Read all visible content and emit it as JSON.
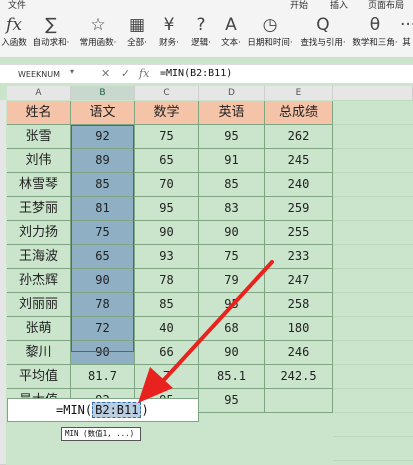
{
  "menu": {
    "start": "开始",
    "insert": "插入",
    "layout": "页面布局",
    "file": "文件"
  },
  "ribbon": [
    {
      "icon": "fx",
      "label": "入函数"
    },
    {
      "icon": "∑",
      "label": "自动求和·"
    },
    {
      "icon": "☆",
      "label": "常用函数·"
    },
    {
      "icon": "▦",
      "label": "全部·"
    },
    {
      "icon": "¥",
      "label": "财务·"
    },
    {
      "icon": "?",
      "label": "逻辑·"
    },
    {
      "icon": "A",
      "label": "文本·"
    },
    {
      "icon": "◷",
      "label": "日期和时间·"
    },
    {
      "icon": "Q",
      "label": "查找与引用·"
    },
    {
      "icon": "θ",
      "label": "数学和三角·"
    },
    {
      "icon": "···",
      "label": "其"
    }
  ],
  "formula_bar": {
    "name_box": "WEEKNUM",
    "formula": "=MIN(B2:B11)"
  },
  "columns": [
    "A",
    "B",
    "C",
    "D",
    "E"
  ],
  "table": {
    "headers": [
      "姓名",
      "语文",
      "数学",
      "英语",
      "总成绩"
    ],
    "rows": [
      [
        "张雪",
        "92",
        "75",
        "95",
        "262"
      ],
      [
        "刘伟",
        "89",
        "65",
        "91",
        "245"
      ],
      [
        "林雪琴",
        "85",
        "70",
        "85",
        "240"
      ],
      [
        "王梦丽",
        "81",
        "95",
        "83",
        "259"
      ],
      [
        "刘力扬",
        "75",
        "90",
        "90",
        "255"
      ],
      [
        "王海波",
        "65",
        "93",
        "75",
        "233"
      ],
      [
        "孙杰辉",
        "90",
        "78",
        "79",
        "247"
      ],
      [
        "刘丽丽",
        "78",
        "85",
        "95",
        "258"
      ],
      [
        "张萌",
        "72",
        "40",
        "68",
        "180"
      ],
      [
        "黎川",
        "90",
        "66",
        "90",
        "246"
      ],
      [
        "平均值",
        "81.7",
        "7",
        "85.1",
        "242.5"
      ],
      [
        "最大值",
        "92",
        "95",
        "95",
        ""
      ]
    ]
  },
  "edit_cell": {
    "prefix": "=MIN(",
    "ref": "B2:B11",
    "suffix": ")"
  },
  "tooltip": "MIN (数值1, ...)",
  "colors": {
    "header_fill": "#f5c4a8",
    "sheet_green": "#cbe5cc",
    "selection": "#8fb0c4",
    "arrow": "#e8231f"
  }
}
